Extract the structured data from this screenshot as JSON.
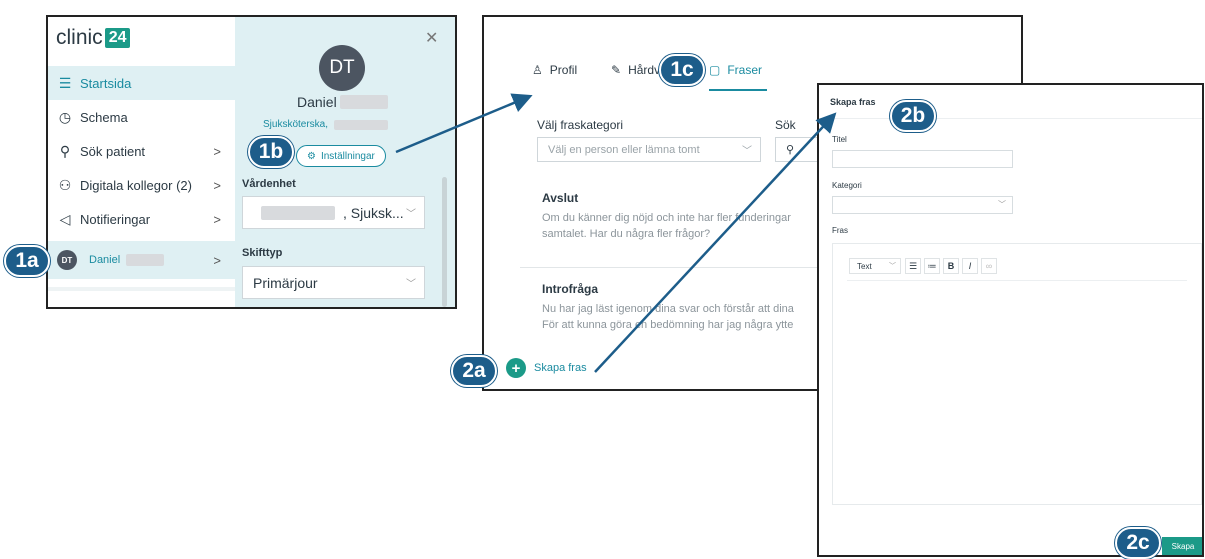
{
  "panel1": {
    "logo": {
      "text": "clinic",
      "badge": "24"
    },
    "nav": [
      {
        "label": "Startsida",
        "icon": "list-icon"
      },
      {
        "label": "Schema",
        "icon": "clock-icon"
      },
      {
        "label": "Sök patient",
        "icon": "search-icon"
      },
      {
        "label": "Digitala kollegor (2)",
        "icon": "people-icon"
      },
      {
        "label": "Notifieringar",
        "icon": "megaphone-icon"
      }
    ],
    "user": {
      "initials": "DT",
      "name": "Daniel"
    },
    "profile": {
      "initials": "DT",
      "name": "Daniel",
      "role": "Sjuksköterska,",
      "settings_label": "Inställningar",
      "unit_label": "Vårdenhet",
      "unit_value": ", Sjuksk...",
      "shift_label": "Skifttyp",
      "shift_value": "Primärjour"
    }
  },
  "panel2": {
    "tabs": [
      {
        "label": "Profil",
        "icon": "person-icon"
      },
      {
        "label": "Hårdv",
        "icon": "pencil-icon"
      },
      {
        "label": "Fraser",
        "icon": "document-icon"
      }
    ],
    "category_label": "Välj fraskategori",
    "category_placeholder": "Välj en person eller lämna tomt",
    "search_label": "Sök",
    "phrases": [
      {
        "title": "Avslut",
        "line1": "Om du känner dig nöjd och inte har fler funderingar",
        "line2": "samtalet. Har du några fler frågor?"
      },
      {
        "title": "Introfråga",
        "line1": "Nu har jag läst igenom dina svar och förstår att dina",
        "line2": "För att kunna göra en bedömning har jag några ytte"
      }
    ],
    "create_label": "Skapa fras"
  },
  "panel3": {
    "title": "Skapa fras",
    "title_label": "Titel",
    "category_label": "Kategori",
    "phrase_label": "Fras",
    "format_value": "Text",
    "bold": "B",
    "italic": "I",
    "submit_label": "Skapa"
  },
  "markers": [
    "1a",
    "1b",
    "1c",
    "2a",
    "2b",
    "2c"
  ],
  "colors": {
    "accent": "#1b9a88",
    "link": "#1a8ba0",
    "marker": "#1d5d8a",
    "active_bg": "#dff0f3"
  }
}
